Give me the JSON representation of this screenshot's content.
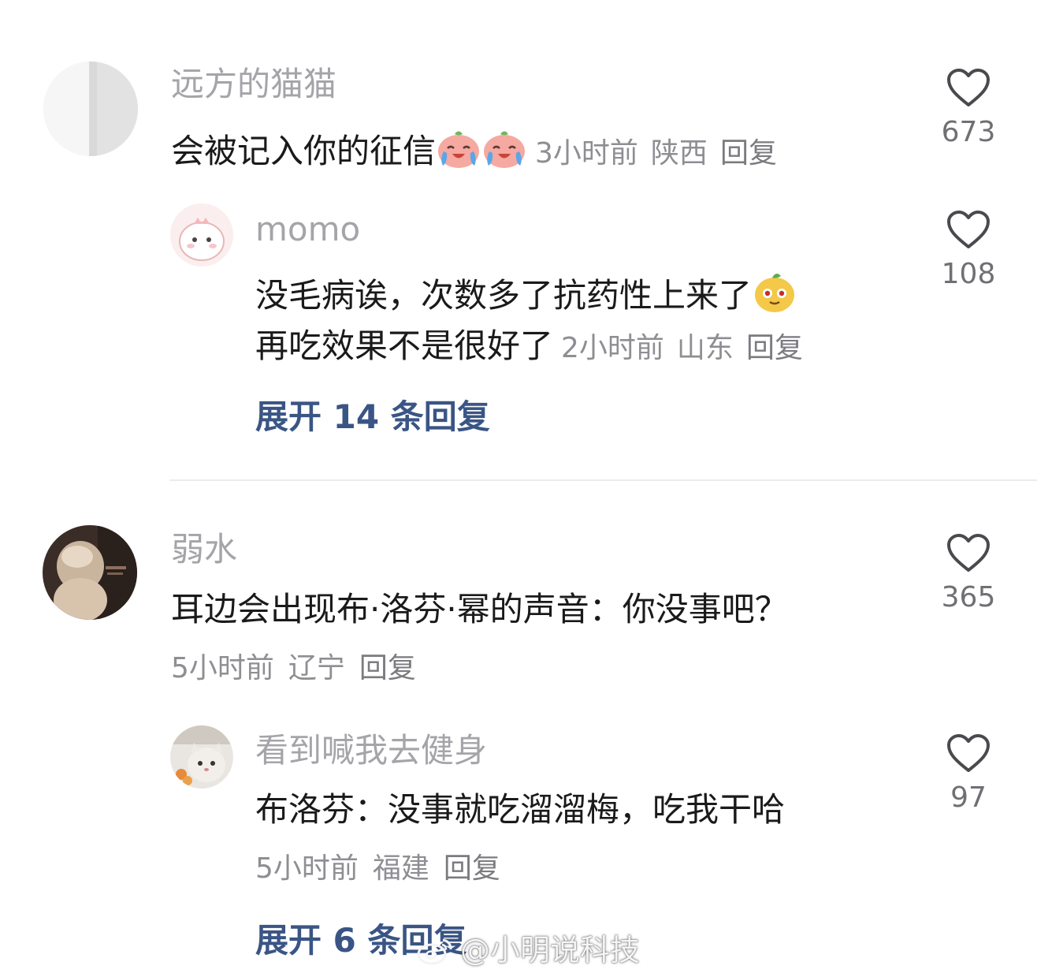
{
  "comments": [
    {
      "username": "远方的猫猫",
      "text": "会被记入你的征信",
      "emoji": [
        "crying-peach-emoji",
        "crying-peach-emoji"
      ],
      "time": "3小时前",
      "location": "陕西",
      "reply_label": "回复",
      "likes": "673",
      "replies": [
        {
          "username": "momo",
          "text_line1": "没毛病诶，次数多了抗药性上来了",
          "emoji": "yellow-pear-emoji",
          "text_line2": "再吃效果不是很好了",
          "time": "2小时前",
          "location": "山东",
          "reply_label": "回复",
          "likes": "108"
        }
      ],
      "expand_label": "展开 14 条回复"
    },
    {
      "username": "弱水",
      "text": "耳边会出现布·洛芬·幂的声音：你没事吧？",
      "time": "5小时前",
      "location": "辽宁",
      "reply_label": "回复",
      "likes": "365",
      "replies": [
        {
          "username": "看到喊我去健身",
          "text": "布洛芬：没事就吃溜溜梅，吃我干哈",
          "time": "5小时前",
          "location": "福建",
          "reply_label": "回复",
          "likes": "97"
        }
      ],
      "expand_label": "展开 6 条回复"
    }
  ],
  "watermark": "@小明说科技",
  "colors": {
    "username": "#a4a4a9",
    "text": "#1a1a1a",
    "meta": "#8e8e93",
    "expand": "#3a5585",
    "divider": "#ececec"
  }
}
